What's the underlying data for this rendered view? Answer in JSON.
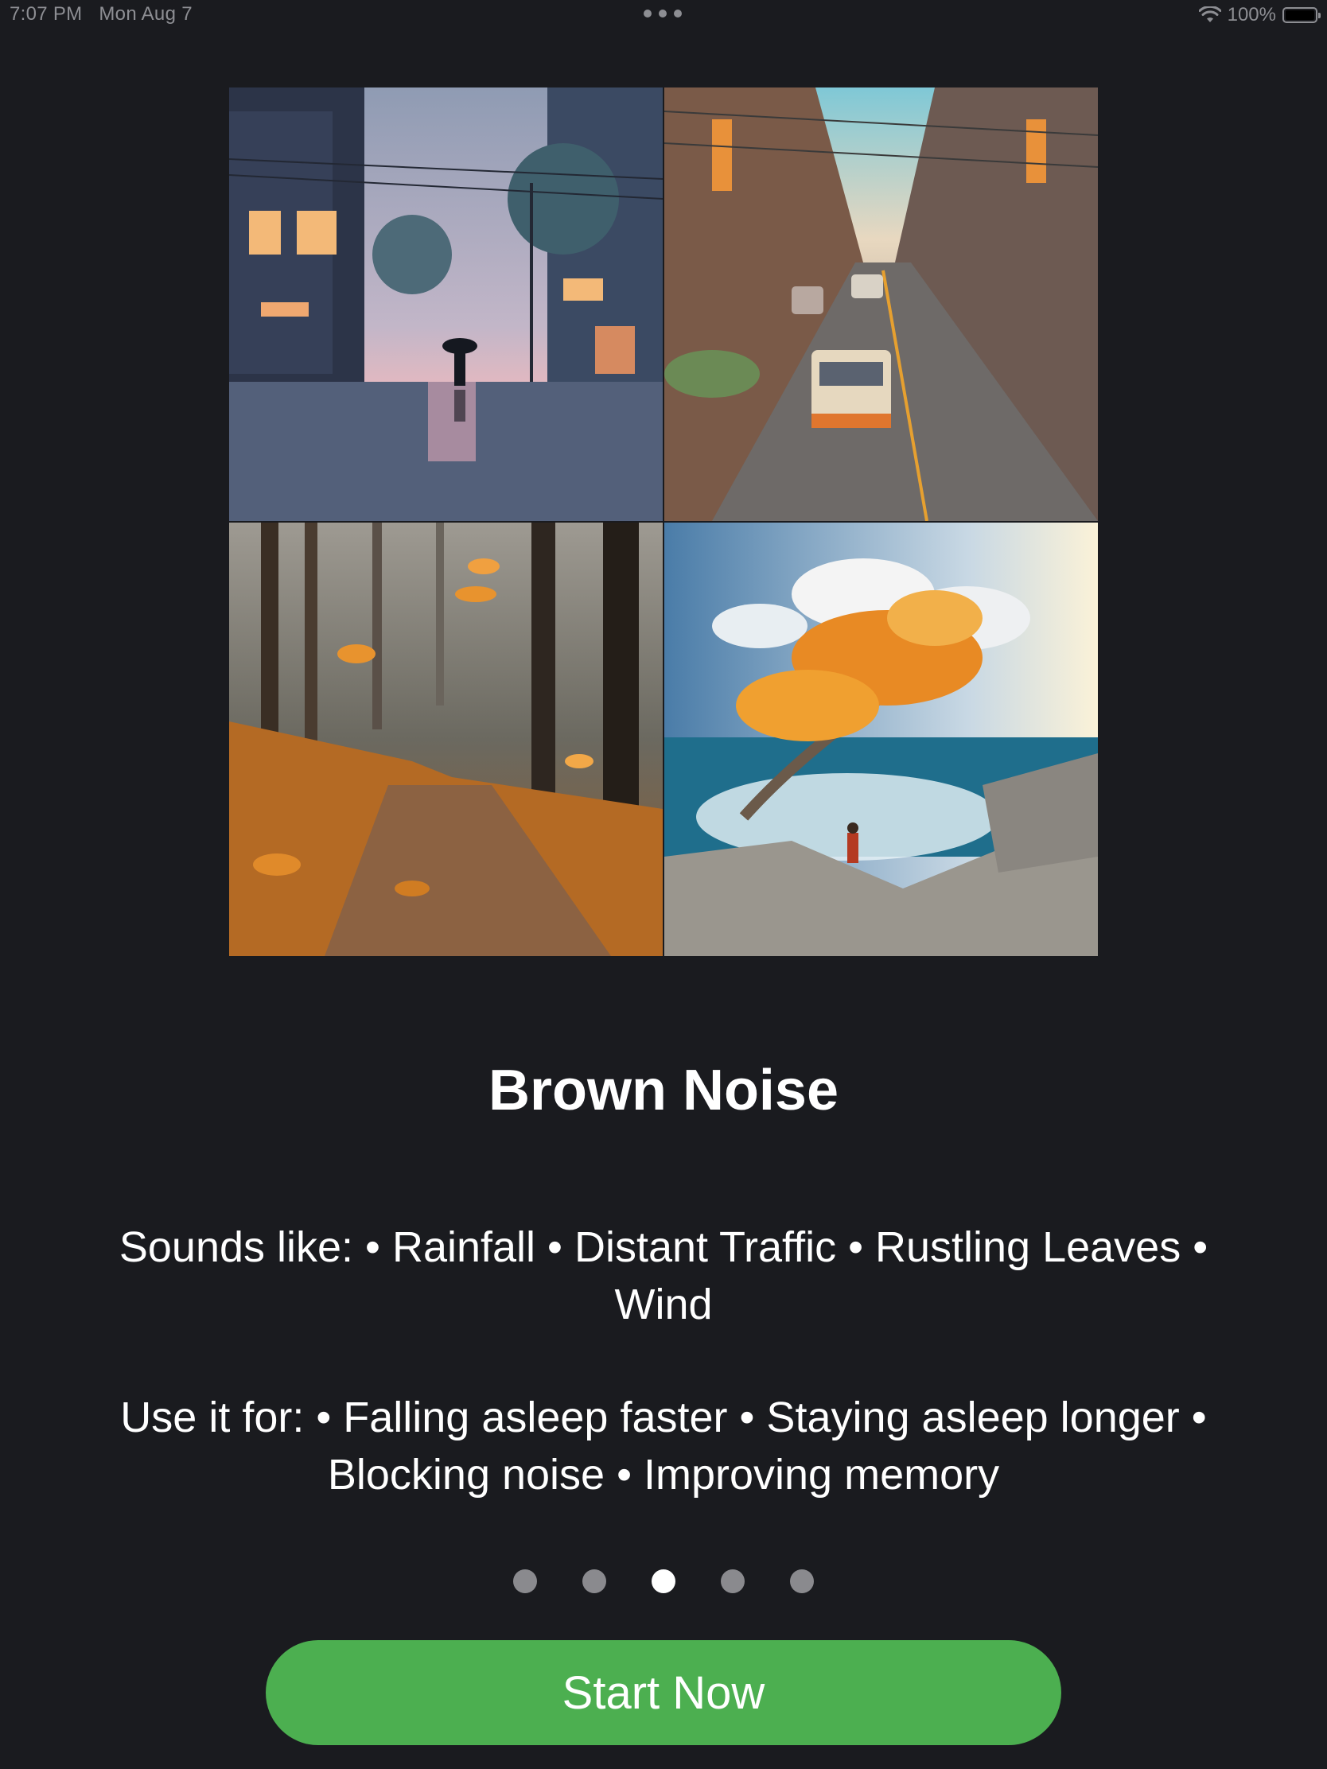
{
  "status_bar": {
    "time": "7:07 PM",
    "date": "Mon Aug 7",
    "battery": "100%",
    "icons": [
      "more-dots-icon",
      "wifi-icon",
      "battery-icon"
    ]
  },
  "illustrations": [
    {
      "icon": "rainy-street-illustration"
    },
    {
      "icon": "city-traffic-illustration"
    },
    {
      "icon": "autumn-forest-illustration"
    },
    {
      "icon": "windy-coast-illustration"
    }
  ],
  "title": "Brown Noise",
  "sounds_like": "Sounds like: • Rainfall • Distant Traffic • Rustling Leaves • Wind",
  "use_it_for": "Use it for: • Falling asleep faster • Staying asleep longer • Blocking noise • Improving memory",
  "pagination": {
    "total": 5,
    "current": 3
  },
  "cta": {
    "label": "Start Now",
    "color": "#4caf50"
  },
  "colors": {
    "background": "#1a1b1f"
  }
}
